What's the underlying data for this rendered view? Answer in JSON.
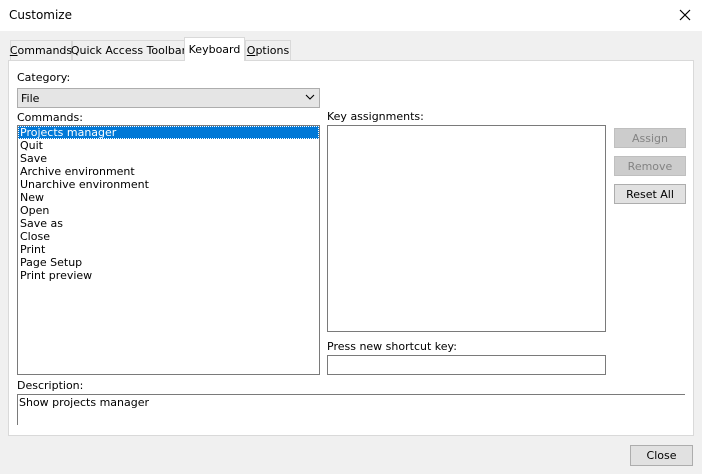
{
  "window": {
    "title": "Customize"
  },
  "tabs": [
    {
      "label": "Commands",
      "underline_char": "C",
      "rest": "ommands",
      "active": false
    },
    {
      "label": "Quick Access Toolbar",
      "active": false
    },
    {
      "label": "Keyboard",
      "active": true
    },
    {
      "label": "Options",
      "underline_char": "O",
      "rest": "ptions",
      "active": false
    }
  ],
  "category": {
    "label": "Category:",
    "value": "File"
  },
  "commands": {
    "label": "Commands:",
    "selected_index": 0,
    "items": [
      "Projects manager",
      "Quit",
      "Save",
      "Archive environment",
      "Unarchive environment",
      "New",
      "Open",
      "Save as",
      "Close",
      "Print",
      "Page Setup",
      "Print preview"
    ]
  },
  "key_assignments": {
    "label": "Key assignments:"
  },
  "shortcut": {
    "label": "Press new shortcut key:",
    "value": ""
  },
  "buttons": {
    "assign": "Assign",
    "remove": "Remove",
    "reset_all": "Reset All",
    "close": "Close"
  },
  "description": {
    "label": "Description:",
    "text": "Show projects manager"
  },
  "icons": {
    "close": "close-icon",
    "dropdown": "chevron-down-icon"
  }
}
